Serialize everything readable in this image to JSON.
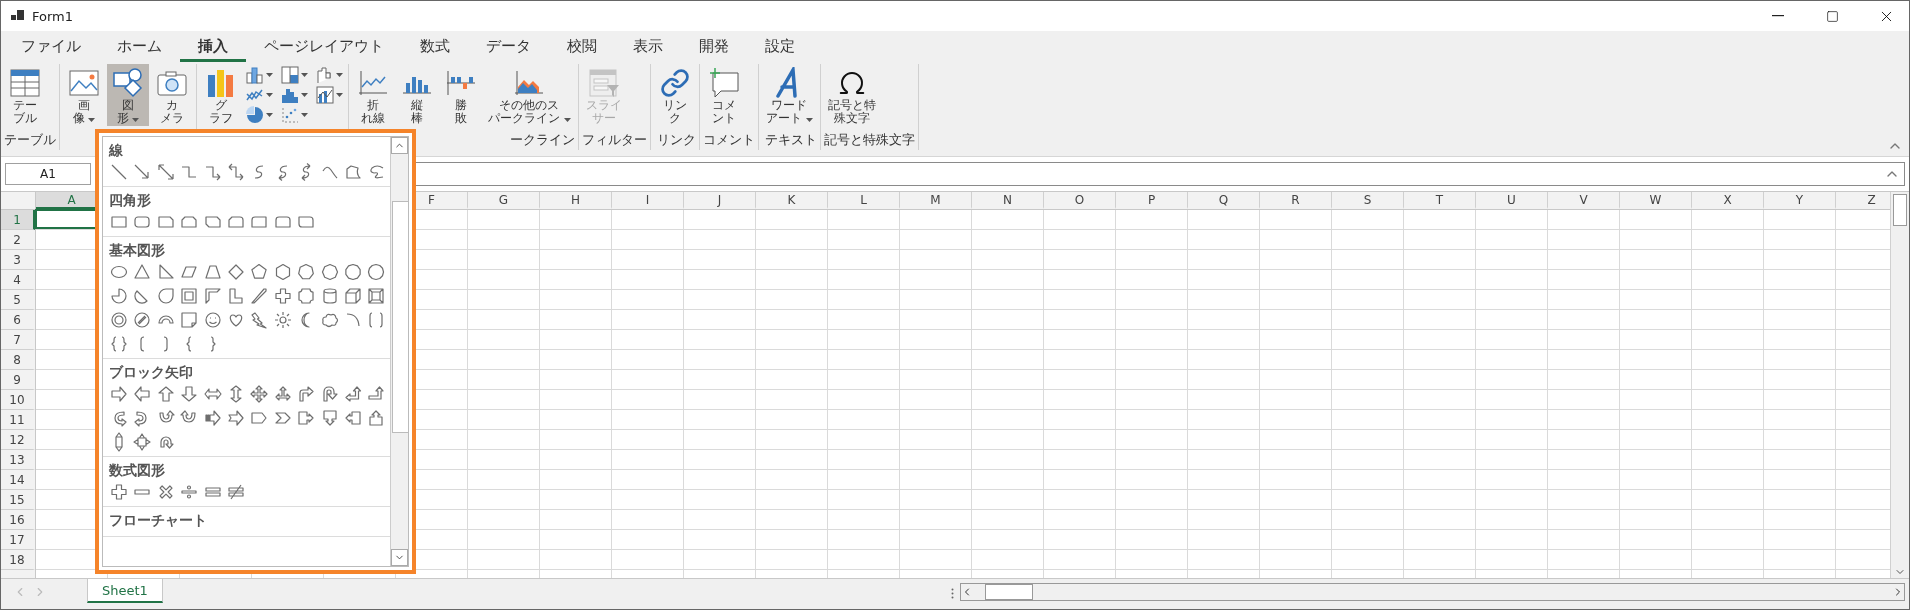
{
  "window": {
    "title": "Form1"
  },
  "tabs": [
    {
      "label": "ファイル",
      "selected": false
    },
    {
      "label": "ホーム",
      "selected": false
    },
    {
      "label": "挿入",
      "selected": true
    },
    {
      "label": "ページレイアウト",
      "selected": false
    },
    {
      "label": "数式",
      "selected": false
    },
    {
      "label": "データ",
      "selected": false
    },
    {
      "label": "校閲",
      "selected": false
    },
    {
      "label": "表示",
      "selected": false
    },
    {
      "label": "開発",
      "selected": false
    },
    {
      "label": "設定",
      "selected": false
    }
  ],
  "ribbon": {
    "groups": [
      {
        "label": "テーブル",
        "buttons": [
          {
            "kind": "table",
            "lines": [
              "テー",
              "ブル"
            ],
            "dropdown": false,
            "pressed": false,
            "disabled": false
          }
        ]
      },
      {
        "buttons": [
          {
            "kind": "picture",
            "lines": [
              "画",
              "像"
            ],
            "dropdown": true,
            "pressed": false,
            "disabled": false
          },
          {
            "kind": "shapes",
            "lines": [
              "図",
              "形"
            ],
            "dropdown": true,
            "pressed": true,
            "disabled": false
          },
          {
            "kind": "camera",
            "lines": [
              "カ",
              "メラ"
            ],
            "dropdown": false,
            "pressed": false,
            "disabled": false
          }
        ]
      },
      {
        "buttons": [
          {
            "kind": "chart",
            "lines": [
              "グ",
              "ラフ"
            ],
            "dropdown": false,
            "pressed": false,
            "disabled": false
          }
        ],
        "small_buttons": [
          {
            "kind": "column_chart"
          },
          {
            "kind": "line_chart"
          },
          {
            "kind": "pie_chart"
          },
          {
            "kind": "treemap_chart"
          },
          {
            "kind": "histogram_chart"
          },
          {
            "kind": "scatter_chart"
          },
          {
            "kind": "waterfall_chart"
          },
          {
            "kind": "combo_chart"
          }
        ]
      },
      {
        "label": "ークライン",
        "buttons": [
          {
            "kind": "sparkline_line",
            "lines": [
              "折",
              "れ線"
            ],
            "dropdown": false,
            "pressed": false,
            "disabled": false
          },
          {
            "kind": "sparkline_column",
            "lines": [
              "縦",
              "棒"
            ],
            "dropdown": false,
            "pressed": false,
            "disabled": false
          },
          {
            "kind": "sparkline_winloss",
            "lines": [
              "勝",
              "敗"
            ],
            "dropdown": false,
            "pressed": false,
            "disabled": false
          },
          {
            "kind": "sparkline_more",
            "lines": [
              "その他のス",
              "パークライン"
            ],
            "dropdown": true,
            "pressed": false,
            "disabled": false
          }
        ]
      },
      {
        "label": "フィルター",
        "buttons": [
          {
            "kind": "slicer",
            "lines": [
              "スライ",
              "サー"
            ],
            "dropdown": false,
            "pressed": false,
            "disabled": true
          }
        ]
      },
      {
        "label": "リンク",
        "buttons": [
          {
            "kind": "link",
            "lines": [
              "リン",
              "ク"
            ],
            "dropdown": false,
            "pressed": false,
            "disabled": false
          }
        ]
      },
      {
        "label": "コメント",
        "buttons": [
          {
            "kind": "comment",
            "lines": [
              "コメ",
              "ント"
            ],
            "dropdown": false,
            "pressed": false,
            "disabled": false
          }
        ]
      },
      {
        "label": "テキスト",
        "buttons": [
          {
            "kind": "wordart",
            "lines": [
              "ワード",
              "アート"
            ],
            "dropdown": true,
            "pressed": false,
            "disabled": false
          }
        ]
      },
      {
        "label": "記号と特殊文字",
        "buttons": [
          {
            "kind": "symbol",
            "lines": [
              "記号と特",
              "殊文字"
            ],
            "dropdown": false,
            "pressed": false,
            "disabled": false
          }
        ]
      }
    ]
  },
  "name_box": {
    "value": "A1"
  },
  "sheet": {
    "columns": [
      {
        "label": "A",
        "selected": true
      },
      {
        "label": "F",
        "selected": false
      },
      {
        "label": "G",
        "selected": false
      },
      {
        "label": "H",
        "selected": false
      },
      {
        "label": "I",
        "selected": false
      },
      {
        "label": "J",
        "selected": false
      },
      {
        "label": "K",
        "selected": false
      },
      {
        "label": "L",
        "selected": false
      },
      {
        "label": "M",
        "selected": false
      },
      {
        "label": "N",
        "selected": false
      },
      {
        "label": "O",
        "selected": false
      },
      {
        "label": "P",
        "selected": false
      },
      {
        "label": "Q",
        "selected": false
      },
      {
        "label": "R",
        "selected": false
      },
      {
        "label": "S",
        "selected": false
      },
      {
        "label": "T",
        "selected": false
      },
      {
        "label": "U",
        "selected": false
      },
      {
        "label": "V",
        "selected": false
      },
      {
        "label": "W",
        "selected": false
      },
      {
        "label": "X",
        "selected": false
      },
      {
        "label": "Y",
        "selected": false
      },
      {
        "label": "Z",
        "selected": false
      }
    ],
    "rows": [
      {
        "label": "1",
        "selected": true
      },
      {
        "label": "2",
        "selected": false
      },
      {
        "label": "3",
        "selected": false
      },
      {
        "label": "4",
        "selected": false
      },
      {
        "label": "5",
        "selected": false
      },
      {
        "label": "6",
        "selected": false
      },
      {
        "label": "7",
        "selected": false
      },
      {
        "label": "8",
        "selected": false
      },
      {
        "label": "9",
        "selected": false
      },
      {
        "label": "10",
        "selected": false
      },
      {
        "label": "11",
        "selected": false
      },
      {
        "label": "12",
        "selected": false
      },
      {
        "label": "13",
        "selected": false
      },
      {
        "label": "14",
        "selected": false
      },
      {
        "label": "15",
        "selected": false
      },
      {
        "label": "16",
        "selected": false
      },
      {
        "label": "17",
        "selected": false
      },
      {
        "label": "18",
        "selected": false
      }
    ]
  },
  "sheet_tabs": [
    {
      "label": "Sheet1",
      "selected": true
    }
  ],
  "shape_gallery": {
    "sections": [
      {
        "kind": "lines",
        "title": "線"
      },
      {
        "kind": "rectangles",
        "title": "四角形"
      },
      {
        "kind": "basic",
        "title": "基本図形"
      },
      {
        "kind": "block_arrows",
        "title": "ブロック矢印"
      },
      {
        "kind": "equation",
        "title": "数式図形"
      },
      {
        "kind": "flowchart",
        "title": "フローチャート"
      }
    ]
  }
}
